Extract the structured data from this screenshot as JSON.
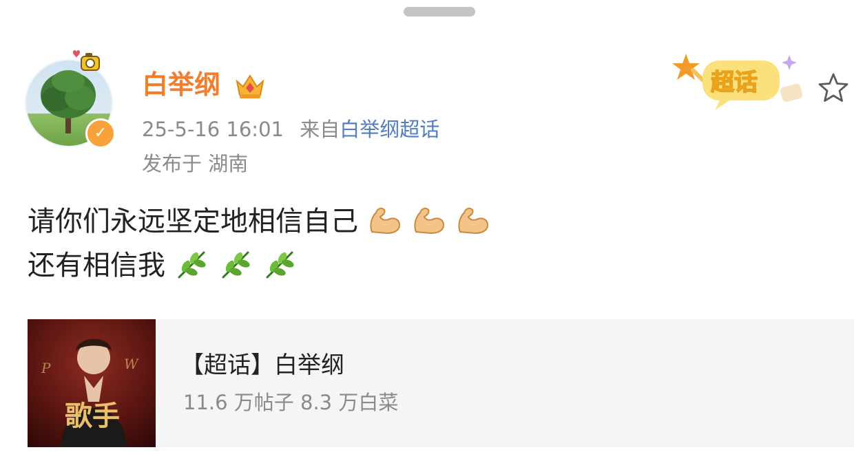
{
  "post": {
    "author_name": "白举纲",
    "timestamp": "25-5-16 16:01",
    "source_prefix": "来自",
    "source_link": "白举纲超话",
    "location": "发布于 湖南",
    "supertopic_badge_label": "超话",
    "content_line1": "请你们永远坚定地相信自己",
    "content_line2": "还有相信我",
    "line1_emoji": "flexed-biceps",
    "line2_emoji": "herb",
    "emoji_repeat": 3
  },
  "card": {
    "title": "【超话】白举纲",
    "stats": "11.6 万帖子 8.3 万白菜",
    "thumbnail_text": "歌手"
  },
  "colors": {
    "username": "#f47d2c",
    "link": "#4f7fbf",
    "meta": "#8a8a8a",
    "verified_badge": "#f7a23a",
    "card_background": "#f5f5f5"
  }
}
